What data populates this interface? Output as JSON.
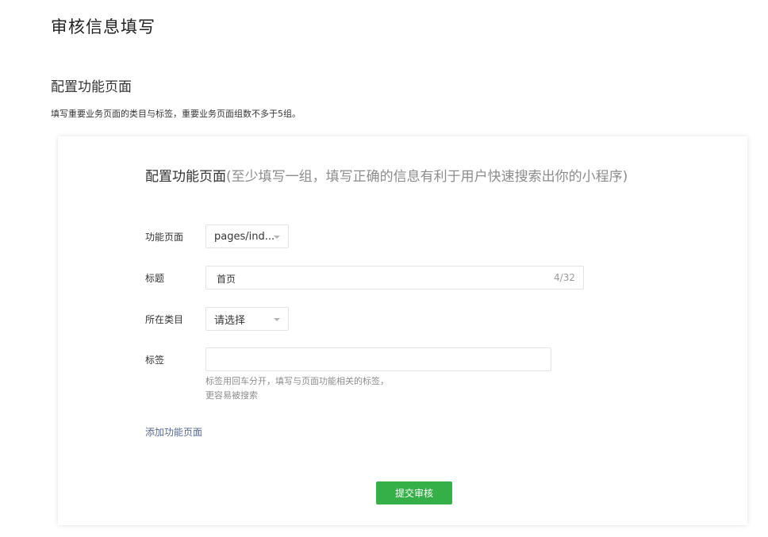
{
  "page": {
    "title": "审核信息填写",
    "section_title": "配置功能页面",
    "section_desc": "填写重要业务页面的类目与标签，重要业务页面组数不多于5组。"
  },
  "card": {
    "title_main": "配置功能页面",
    "title_hint": "(至少填写一组，填写正确的信息有利于用户快速搜索出你的小程序)",
    "page_select": {
      "label": "功能页面",
      "value": "pages/ind..."
    },
    "title_field": {
      "label": "标题",
      "value": "首页",
      "counter": "4/32"
    },
    "category_select": {
      "label": "所在类目",
      "value": "请选择"
    },
    "tags_field": {
      "label": "标签",
      "value": "",
      "tip_line1": "标签用回车分开，填写与页面功能相关的标签，",
      "tip_line2": "更容易被搜索"
    },
    "add_link": "添加功能页面",
    "submit_label": "提交审核"
  },
  "colors": {
    "accent_green": "#35b048",
    "link_blue": "#576b95"
  }
}
